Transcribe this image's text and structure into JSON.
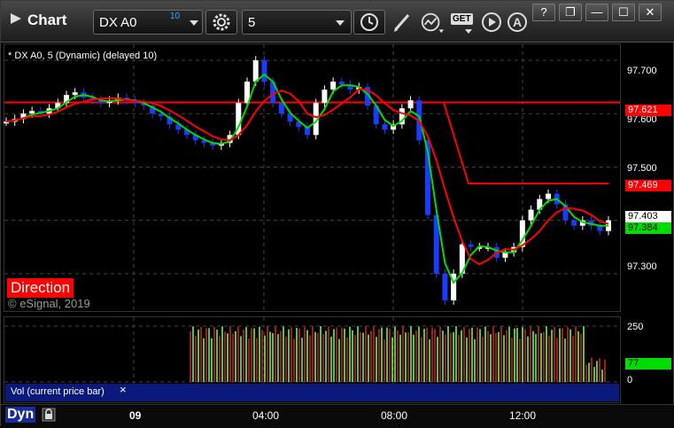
{
  "window": {
    "title": "Chart",
    "buttons": [
      {
        "name": "help-button",
        "label": "?"
      },
      {
        "name": "restore-button",
        "label": "❐"
      },
      {
        "name": "minimize-button",
        "label": "—"
      },
      {
        "name": "maximize-button",
        "label": "☐"
      },
      {
        "name": "close-button",
        "label": "✕"
      }
    ]
  },
  "toolbar": {
    "symbol": "DX A0",
    "delay_badge": "10",
    "interval": "5",
    "get_label": "GET",
    "toolbar_icons": [
      "gear-icon",
      "clock-icon",
      "pen-icon",
      "indicator-icon",
      "get-data-icon",
      "play-icon",
      "annotation-icon"
    ]
  },
  "price_panel": {
    "study_label": "* DX A0, 5 (Dynamic) (delayed 10)",
    "direction_label": "Direction",
    "copyright": "© eSignal, 2019",
    "y_ticks": [
      "97.700",
      "97.600",
      "97.500",
      "97.300"
    ],
    "tags": [
      {
        "label": "97.621",
        "bg": "#ff0000",
        "fg": "#ffffff"
      },
      {
        "label": "97.469",
        "bg": "#ff0000",
        "fg": "#ffffff"
      },
      {
        "label": "97.403",
        "bg": "#ffffff",
        "fg": "#000000"
      },
      {
        "label": "97.384",
        "bg": "#00dd00",
        "fg": "#000000"
      }
    ]
  },
  "volume_panel": {
    "label": "Vol (current price bar)",
    "close_glyph": "×",
    "y_ticks": [
      "250",
      "0"
    ],
    "tag": {
      "label": "77",
      "bg": "#00dd00",
      "fg": "#000000"
    }
  },
  "time_axis": {
    "mode_label": "Dyn",
    "labels": [
      "09",
      "04:00",
      "08:00",
      "12:00"
    ]
  },
  "colors": {
    "up_candle": "#ffffff",
    "down_candle": "#1a3cff",
    "fast_ma": "#00dd00",
    "slow_ma": "#ff0000",
    "reference_lines": "#ff0000",
    "vol_up": "#7fff4f",
    "vol_down": "#cc2a1a"
  },
  "chart_data": {
    "type": "candlestick",
    "ylim": [
      97.23,
      97.73
    ],
    "reference_levels": [
      97.621,
      97.469
    ],
    "close_series": [
      97.585,
      97.59,
      97.6,
      97.605,
      97.6,
      97.61,
      97.62,
      97.635,
      97.64,
      97.63,
      97.625,
      97.62,
      97.625,
      97.63,
      97.625,
      97.62,
      97.615,
      97.6,
      97.595,
      97.58,
      97.57,
      97.56,
      97.55,
      97.545,
      97.54,
      97.545,
      97.56,
      97.62,
      97.66,
      97.7,
      97.66,
      97.62,
      97.6,
      97.585,
      97.575,
      97.56,
      97.62,
      97.645,
      97.66,
      97.655,
      97.645,
      97.65,
      97.615,
      97.58,
      97.57,
      97.58,
      97.61,
      97.625,
      97.55,
      97.41,
      97.3,
      97.25,
      97.3,
      97.355,
      97.35,
      97.35,
      97.35,
      97.33,
      97.34,
      97.35,
      97.4,
      97.42,
      97.44,
      97.45,
      97.43,
      97.4,
      97.39,
      97.4,
      97.39,
      97.38,
      97.4
    ],
    "volume": {
      "ylim": [
        0,
        270
      ],
      "last": 77
    }
  }
}
